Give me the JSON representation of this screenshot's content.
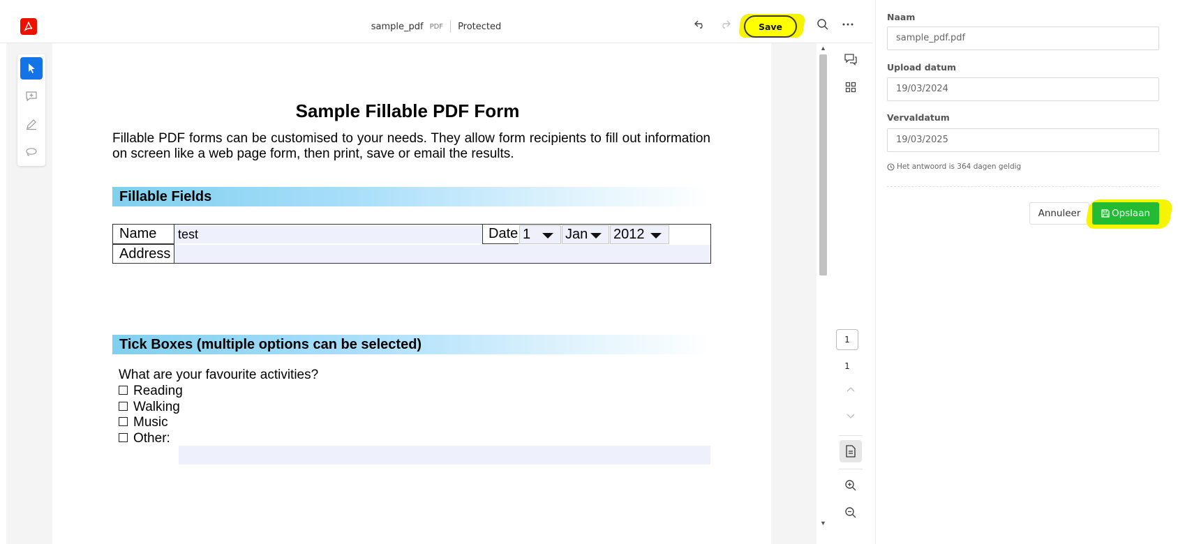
{
  "toolbar": {
    "doc_name": "sample_pdf",
    "doc_type": "PDF",
    "protection": "Protected",
    "save_label": "Save"
  },
  "pdf": {
    "title": "Sample Fillable PDF Form",
    "intro": "Fillable PDF forms can be customised to your needs. They allow form recipients to fill out information on screen like a web page form, then print, save or email the results.",
    "fillable_header": "Fillable Fields",
    "name_label": "Name",
    "name_value": "test",
    "date_label": "Date",
    "date_day": "1",
    "date_month": "Jan",
    "date_year": "2012",
    "address_label": "Address",
    "address_value": "",
    "tick_header": "Tick Boxes (multiple options can be selected)",
    "tick_question": "What are your favourite activities?",
    "options": [
      "Reading",
      "Walking",
      "Music",
      "Other:"
    ]
  },
  "pager": {
    "current_page": "1",
    "total_pages": "1"
  },
  "form": {
    "name_label": "Naam",
    "name_value": "sample_pdf.pdf",
    "upload_label": "Upload datum",
    "upload_value": "19/03/2024",
    "expiry_label": "Vervaldatum",
    "expiry_value": "19/03/2025",
    "help_text": "Het antwoord is 364 dagen geldig",
    "cancel_label": "Annuleer",
    "save_label": "Opslaan"
  },
  "colors": {
    "brand_red": "#eb1000",
    "accent_blue": "#1473e6",
    "highlight_yellow": "#ffff00",
    "save_green": "#22bb33"
  },
  "icons": [
    "acrobat-logo-icon",
    "undo-icon",
    "redo-icon",
    "search-icon",
    "more-icon",
    "select-cursor-icon",
    "add-comment-icon",
    "draw-icon",
    "lasso-icon",
    "comments-icon",
    "thumbnails-icon",
    "page-up-icon",
    "page-down-icon",
    "page-fit-icon",
    "zoom-in-icon",
    "zoom-out-icon",
    "clock-icon",
    "save-disk-icon"
  ]
}
